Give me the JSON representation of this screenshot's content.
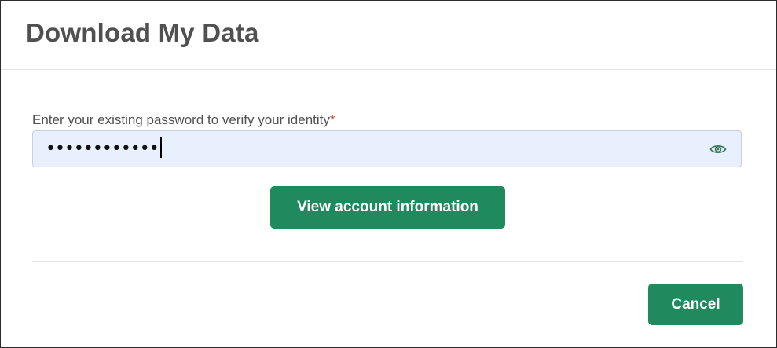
{
  "dialog": {
    "title": "Download My Data"
  },
  "password": {
    "label": "Enter your existing password to verify your identity",
    "required_marker": "*",
    "value": "••••••••••••",
    "toggle_icon": "eye-icon"
  },
  "actions": {
    "view_label": "View account information",
    "cancel_label": "Cancel"
  },
  "colors": {
    "primary_button": "#1f8a5d",
    "input_background": "#e8f0fe",
    "required": "#c0392b",
    "title": "#505050"
  }
}
